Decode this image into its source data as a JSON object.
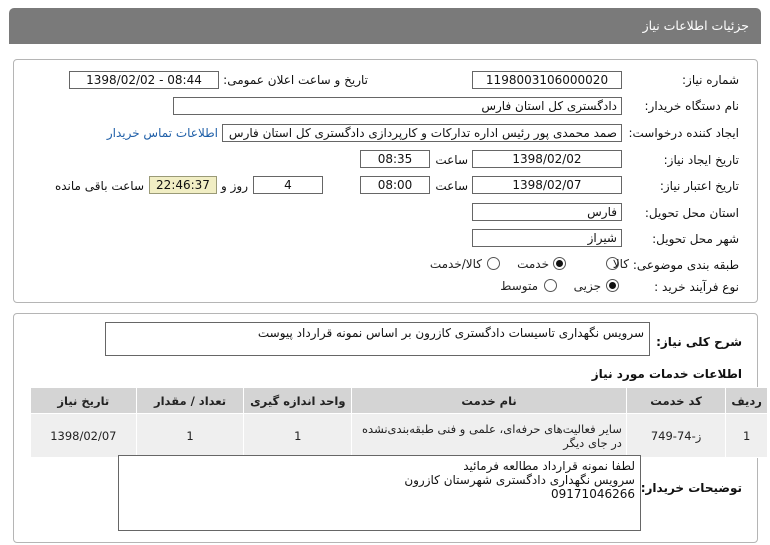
{
  "header": {
    "title": "جزئیات اطلاعات نیاز"
  },
  "form": {
    "need_number": {
      "label": "شماره نیاز:",
      "value": "1198003106000020"
    },
    "announce": {
      "label": "تاریخ و ساعت اعلان عمومی:",
      "value": "1398/02/02 - 08:44"
    },
    "buyer_org": {
      "label": "نام دستگاه خریدار:",
      "value": "دادگستری کل استان فارس"
    },
    "requester": {
      "label": "ایجاد کننده درخواست:",
      "value": "صمد محمدی پور رئیس اداره تدارکات و کارپردازی دادگستری کل استان فارس",
      "contact_link": "اطلاعات تماس خریدار"
    },
    "created": {
      "label": "تاریخ ایجاد نیاز:",
      "date": "1398/02/02",
      "time_label": "ساعت",
      "time": "08:35"
    },
    "validity": {
      "label": "تاریخ اعتبار نیاز:",
      "date": "1398/02/07",
      "time_label": "ساعت",
      "time": "08:00",
      "days": "4",
      "days_label": "روز و",
      "remaining": "22:46:37",
      "remaining_label": "ساعت باقی مانده"
    },
    "province": {
      "label": "استان محل تحویل:",
      "value": "فارس"
    },
    "city": {
      "label": "شهر محل تحویل:",
      "value": "شیراز"
    },
    "category": {
      "label": "طبقه بندی موضوعی:",
      "options": [
        "کالا",
        "خدمت",
        "کالا/خدمت"
      ],
      "selected": "خدمت"
    },
    "purchase_type": {
      "label": "نوع فرآیند خرید :",
      "options": [
        "جزیی",
        "متوسط"
      ],
      "selected": "جزیی"
    }
  },
  "summary": {
    "label": "شرح کلی نیاز:",
    "value": "سرویس نگهداری تاسیسات دادگستری کازرون بر اساس نمونه قرارداد پیوست"
  },
  "services": {
    "title": "اطلاعات خدمات مورد نیاز",
    "columns": [
      "ردیف",
      "کد خدمت",
      "نام خدمت",
      "واحد اندازه گیری",
      "تعداد / مقدار",
      "تاریخ نیاز"
    ],
    "rows": [
      {
        "row": "1",
        "code": "ز-74-749",
        "name": "سایر فعالیت‌های حرفه‌ای، علمی و فنی طبقه‌بندی‌نشده در جای دیگر",
        "unit": "1",
        "qty": "1",
        "date": "1398/02/07"
      }
    ]
  },
  "buyer_notes": {
    "label": "توضیحات خریدار:",
    "lines": [
      "لطفا نمونه قرارداد مطالعه فرمائید",
      "سرویس نگهداری دادگستری شهرستان کازرون",
      "09171046266"
    ]
  },
  "colors": {
    "header_bg": "#7a7a7a",
    "link": "#1f5fa8",
    "highlight": "#f1eec4",
    "table_header": "#d4d4d4",
    "table_cell": "#efefef"
  }
}
